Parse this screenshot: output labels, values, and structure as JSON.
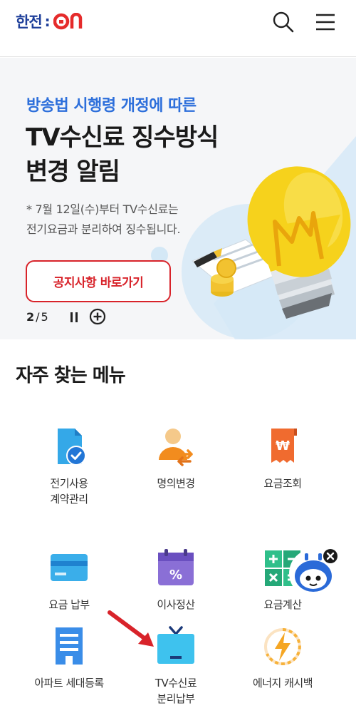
{
  "header": {
    "logo_korean": "한전",
    "logo_on": "ON",
    "search_label": "검색",
    "menu_label": "메뉴"
  },
  "banner": {
    "subtitle": "방송법 시행령 개정에 따른",
    "title_line1": "TV수신료 징수방식",
    "title_line2": "변경 알림",
    "desc_line1": "* 7월 12일(수)부터 TV수신료는",
    "desc_line2": "전기요금과 분리하여 징수됩니다.",
    "button_label": "공지사항 바로가기",
    "pager_current": "2",
    "pager_separator": "/",
    "pager_total": "5"
  },
  "frequent_menu": {
    "title": "자주 찾는 메뉴",
    "items": [
      {
        "label_line1": "전기사용",
        "label_line2": "계약관리",
        "icon": "document-check-icon"
      },
      {
        "label_line1": "명의변경",
        "label_line2": "",
        "icon": "person-swap-icon"
      },
      {
        "label_line1": "요금조회",
        "label_line2": "",
        "icon": "receipt-won-icon"
      },
      {
        "label_line1": "요금 납부",
        "label_line2": "",
        "icon": "credit-card-icon"
      },
      {
        "label_line1": "이사정산",
        "label_line2": "",
        "icon": "calendar-percent-icon"
      },
      {
        "label_line1": "요금계산",
        "label_line2": "",
        "icon": "calculator-icon"
      },
      {
        "label_line1": "아파트 세대등록",
        "label_line2": "",
        "icon": "apartment-icon"
      },
      {
        "label_line1": "TV수신료",
        "label_line2": "분리납부",
        "icon": "tv-icon"
      },
      {
        "label_line1": "에너지 캐시백",
        "label_line2": "",
        "icon": "lightning-cashback-icon"
      }
    ]
  },
  "colors": {
    "brand_blue": "#1e3f9a",
    "brand_red": "#e52b2b",
    "accent_blue": "#2d6fdb",
    "button_red": "#d8232a"
  }
}
